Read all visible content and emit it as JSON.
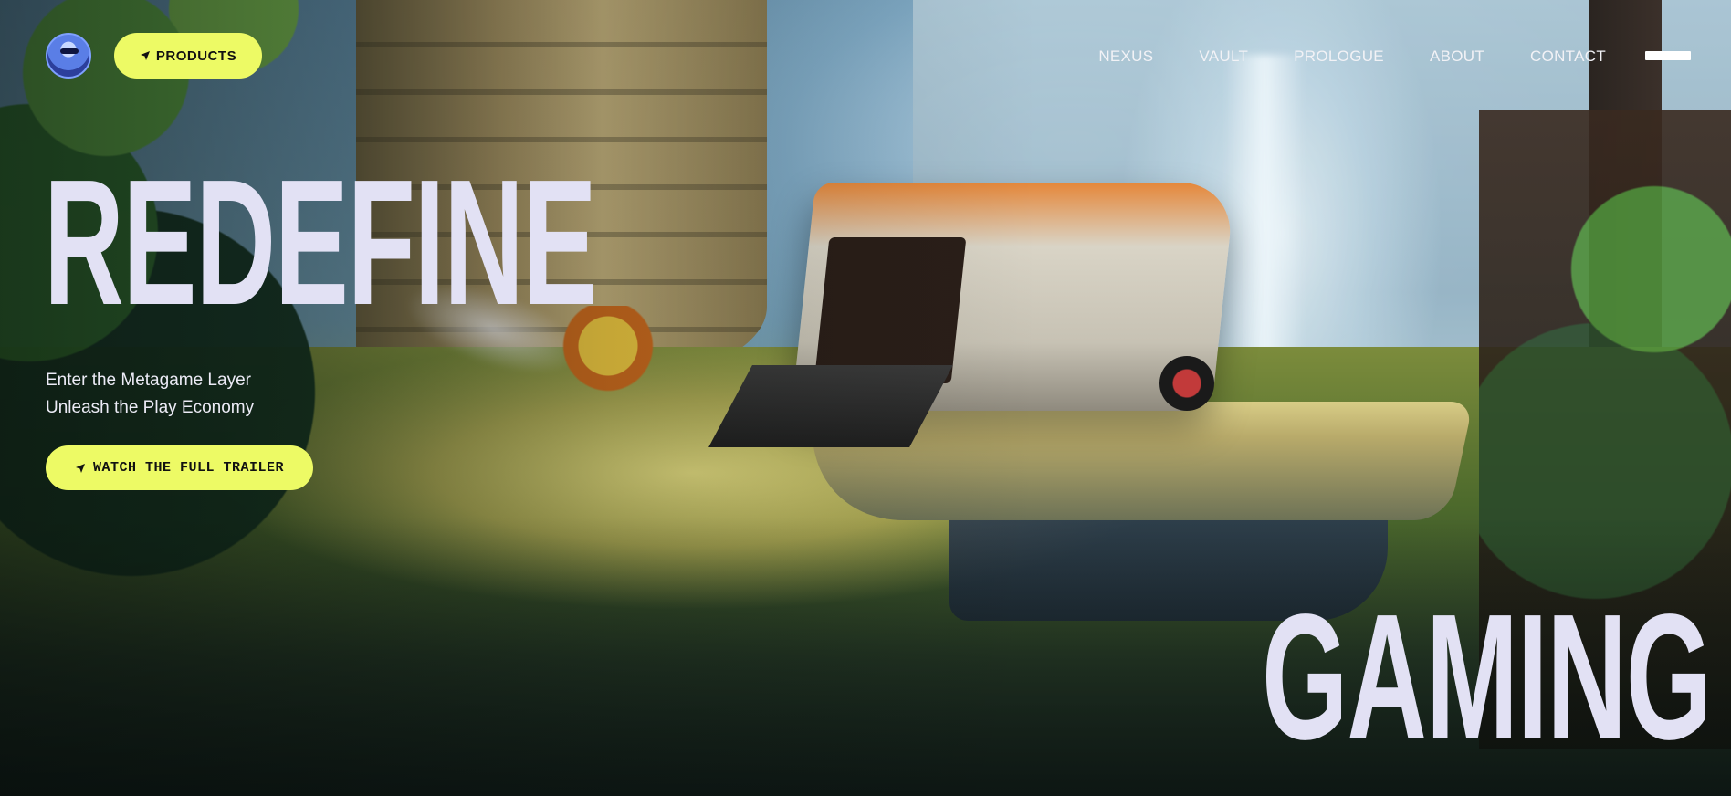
{
  "header": {
    "products_label": "PRODUCTS",
    "nav": [
      "NEXUS",
      "VAULT",
      "PROLOGUE",
      "ABOUT",
      "CONTACT"
    ]
  },
  "hero": {
    "headline_top": "REDEFINE",
    "headline_bottom": "GAMING",
    "subtitle_line1": "Enter the Metagame Layer",
    "subtitle_line2": "Unleash the Play Economy",
    "cta_label": "WATCH THE FULL TRAILER"
  },
  "colors": {
    "accent": "#edfa65",
    "headline": "#e2e1f4",
    "nav_text": "#f2f2f6"
  },
  "icons": {
    "button_icon": "navigation-arrow-icon",
    "menu": "menu-bar-icon"
  }
}
